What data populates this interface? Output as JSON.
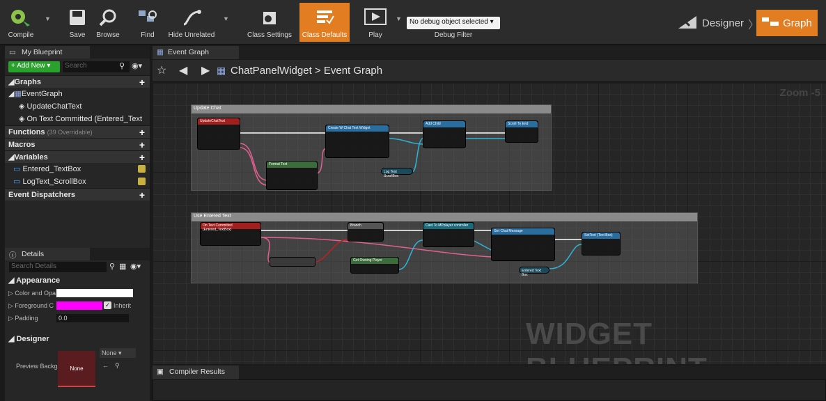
{
  "toolbar": {
    "compile": "Compile",
    "save": "Save",
    "browse": "Browse",
    "find": "Find",
    "hide_unrelated": "Hide Unrelated",
    "class_settings": "Class Settings",
    "class_defaults": "Class Defaults",
    "play": "Play",
    "debug_select": "No debug object selected",
    "debug_label": "Debug Filter",
    "mode_designer": "Designer",
    "mode_graph": "Graph"
  },
  "my_blueprint": {
    "tab": "My Blueprint",
    "add_new": "+ Add New",
    "search_placeholder": "Search",
    "graphs": "Graphs",
    "event_graph": "EventGraph",
    "update_chat": "UpdateChatText",
    "on_text_committed": "On Text Committed (Entered_Text",
    "functions": "Functions",
    "functions_note": "(39 Overridable)",
    "macros": "Macros",
    "variables": "Variables",
    "var1": "Entered_TextBox",
    "var2": "LogText_ScrollBox",
    "event_dispatchers": "Event Dispatchers"
  },
  "details": {
    "tab": "Details",
    "search_placeholder": "Search Details",
    "appearance": "Appearance",
    "color_label": "Color and Opa",
    "foreground_label": "Foreground C",
    "inherit": "Inherit",
    "padding_label": "Padding",
    "padding_value": "0.0",
    "designer": "Designer",
    "preview_label": "Preview Backg",
    "preview_value": "None",
    "preview_select": "None"
  },
  "graph": {
    "tab": "Event Graph",
    "breadcrumb_root": "ChatPanelWidget",
    "breadcrumb_sep": ">",
    "breadcrumb_leaf": "Event Graph",
    "zoom": "Zoom -5",
    "watermark": "WIDGET BLUEPRINT",
    "comment1": "Update Chat",
    "comment2": "Use Entered Text",
    "nodes": {
      "update_chat_text": "UpdateChatText",
      "create_widget": "Create W Chat Text Widget",
      "add_child": "Add Child",
      "scroll_to_end": "Scroll To End",
      "format_text": "Format Text",
      "log_text_scrollbox": "Log Text ScrollBox",
      "on_text_committed": "On Text Committed (Entered_TextBox)",
      "branch": "Branch",
      "cast_to": "Cast To MPplayer controller",
      "get_owning_player": "Get Owning Player",
      "get_chat_message": "Get Chat Message",
      "set_text": "SetText (Text Box)",
      "entered_text_box": "Entered Text Box"
    }
  },
  "compiler": {
    "tab": "Compiler Results"
  },
  "colors": {
    "accent": "#e37d21",
    "add_new": "#29a12c",
    "foreground_color": "#ff00ff"
  }
}
